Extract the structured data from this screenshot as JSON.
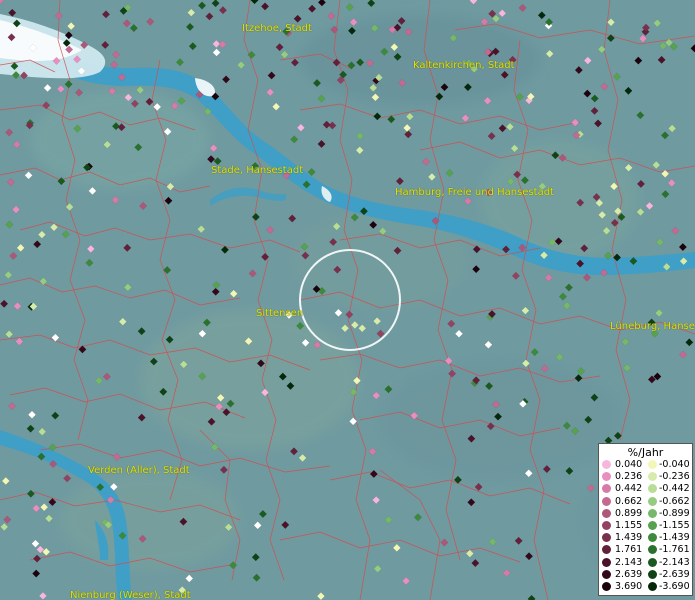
{
  "map": {
    "labels": [
      {
        "id": "itzehoe",
        "text": "Itzehoe, Stadt"
      },
      {
        "id": "kaltenkirchen",
        "text": "Kaltenkirchen, Stadt"
      },
      {
        "id": "stade",
        "text": "Stade, Hansestadt"
      },
      {
        "id": "hamburg",
        "text": "Hamburg, Freie und Hansestadt"
      },
      {
        "id": "sittensen",
        "text": "Sittensen"
      },
      {
        "id": "lueneburg",
        "text": "Lüneburg, Hanse"
      },
      {
        "id": "verden",
        "text": "Verden (Aller), Stadt"
      },
      {
        "id": "nienburg",
        "text": "Nienburg (Weser), Stadt"
      }
    ],
    "colors": {
      "water": "#3f9fc6",
      "land": "#6f9aa0",
      "borders": "#d84a4a",
      "label": "#e2e200"
    }
  },
  "legend": {
    "title": "%/Jahr",
    "positive": [
      {
        "value": "0.040",
        "color": "#f7b6dc"
      },
      {
        "value": "0.236",
        "color": "#e98fc0"
      },
      {
        "value": "0.442",
        "color": "#d67aa8"
      },
      {
        "value": "0.662",
        "color": "#c26a92"
      },
      {
        "value": "0.899",
        "color": "#ad5779"
      },
      {
        "value": "1.155",
        "color": "#934362"
      },
      {
        "value": "1.439",
        "color": "#7a304c"
      },
      {
        "value": "1.761",
        "color": "#62203a"
      },
      {
        "value": "2.143",
        "color": "#4b1229"
      },
      {
        "value": "2.639",
        "color": "#34081b"
      },
      {
        "value": "3.690",
        "color": "#1c020d"
      }
    ],
    "negative": [
      {
        "value": "-0.040",
        "color": "#f2f7b6"
      },
      {
        "value": "-0.236",
        "color": "#d7ecaa"
      },
      {
        "value": "-0.442",
        "color": "#b8de96"
      },
      {
        "value": "-0.662",
        "color": "#96cc80"
      },
      {
        "value": "-0.899",
        "color": "#75b867"
      },
      {
        "value": "-1.155",
        "color": "#56a24e"
      },
      {
        "value": "-1.439",
        "color": "#3d8a3b"
      },
      {
        "value": "-1.761",
        "color": "#2a722c"
      },
      {
        "value": "-2.143",
        "color": "#1b5a1f"
      },
      {
        "value": "-2.639",
        "color": "#0f4214"
      },
      {
        "value": "-3.690",
        "color": "#04290a"
      }
    ]
  }
}
